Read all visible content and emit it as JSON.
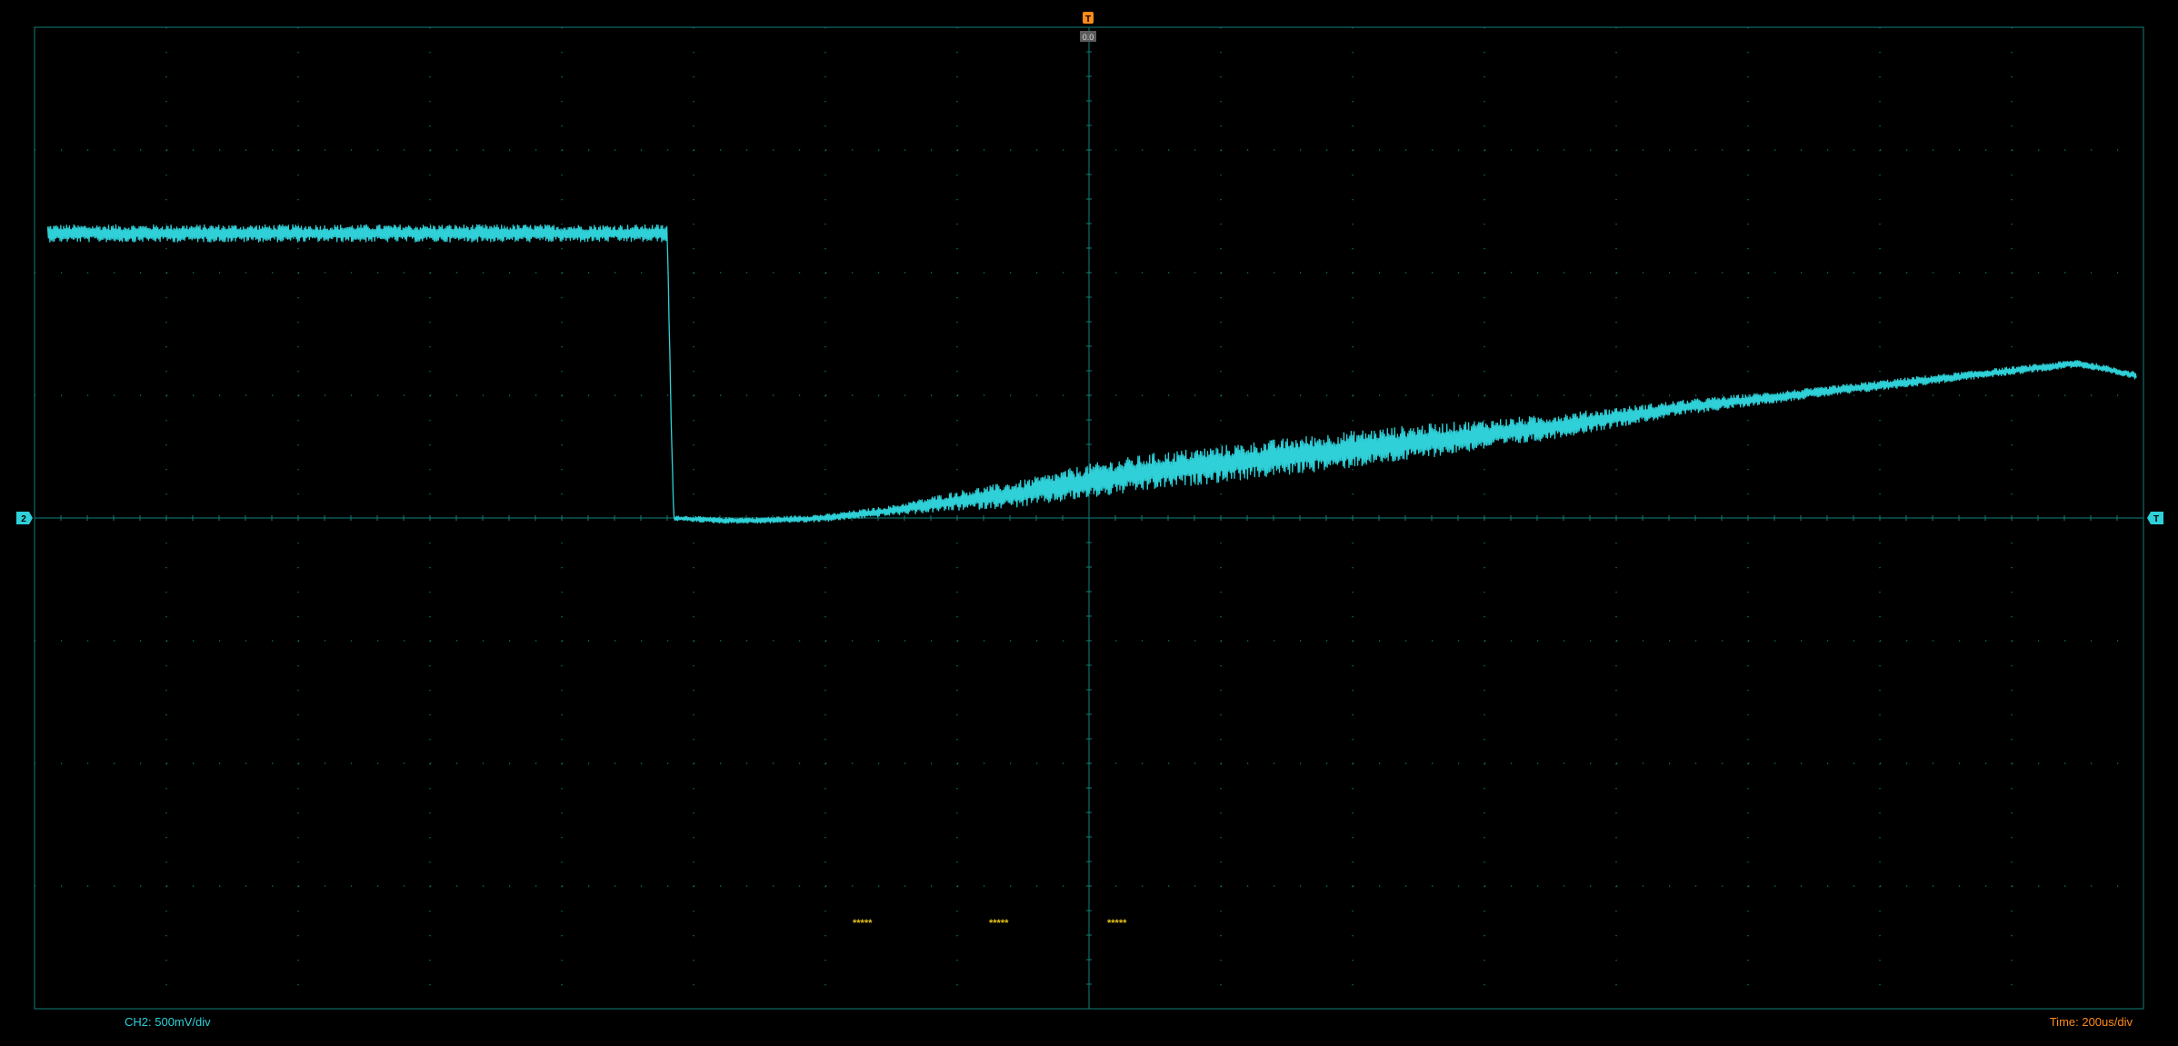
{
  "scope": {
    "ch2_scale_label": "CH2: 500mV/div",
    "timebase_label": "Time: 200us/div",
    "trigger_marker": "T",
    "trigger_status": "0.0",
    "ch2_marker": "2",
    "trigger_level_marker": "T",
    "measurement_placeholders": [
      "*****",
      "*****",
      "*****"
    ],
    "colors": {
      "background": "#000000",
      "grid": "#0f7f7a",
      "trace": "#2fd0d8",
      "trigger": "#ff8a1a",
      "measure": "#e8c21a"
    }
  },
  "chart_data": {
    "type": "line",
    "title": "",
    "xlabel": "",
    "ylabel": "",
    "x_unit": "us",
    "y_unit": "V",
    "x_div": 200,
    "y_div": 0.5,
    "xlim": [
      -1600,
      1600
    ],
    "ylim": [
      -2.0,
      2.0
    ],
    "grid": true,
    "series": [
      {
        "channel": "CH2",
        "x": [
          -1580,
          -640,
          -634,
          -630,
          -560,
          -500,
          -400,
          -300,
          -200,
          -100,
          0,
          100,
          200,
          300,
          400,
          500,
          600,
          700,
          800,
          900,
          1000,
          1100,
          1200,
          1300,
          1400,
          1500,
          1590
        ],
        "values": [
          1.16,
          1.16,
          0.4,
          0.0,
          -0.01,
          -0.01,
          0.0,
          0.03,
          0.07,
          0.1,
          0.15,
          0.19,
          0.22,
          0.25,
          0.28,
          0.31,
          0.34,
          0.37,
          0.41,
          0.45,
          0.48,
          0.51,
          0.54,
          0.57,
          0.6,
          0.63,
          0.58
        ],
        "noise_amplitude": [
          0.035,
          0.035,
          0.0,
          0.01,
          0.012,
          0.012,
          0.015,
          0.02,
          0.04,
          0.055,
          0.07,
          0.075,
          0.075,
          0.075,
          0.075,
          0.07,
          0.06,
          0.05,
          0.04,
          0.03,
          0.025,
          0.02,
          0.02,
          0.018,
          0.016,
          0.015,
          0.015
        ]
      }
    ]
  }
}
